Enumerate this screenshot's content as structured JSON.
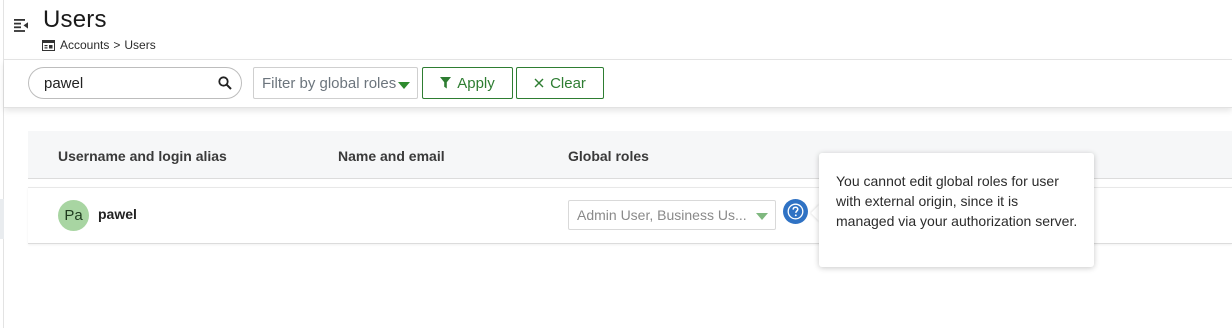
{
  "header": {
    "title": "Users",
    "breadcrumb": {
      "parent": "Accounts",
      "separator": ">",
      "current": "Users"
    }
  },
  "toolbar": {
    "search_value": "pawel",
    "roles_filter_placeholder": "Filter by global roles",
    "apply_label": "Apply",
    "clear_label": "Clear"
  },
  "table": {
    "columns": [
      "Username and login alias",
      "Name and email",
      "Global roles"
    ],
    "rows": [
      {
        "avatar_initials": "Pa",
        "username": "pawel",
        "name_email": "",
        "global_roles": "Admin User, Business Us..."
      }
    ]
  },
  "tooltip": {
    "text": "You cannot edit global roles for user with external origin, since it is managed via your authorization server."
  },
  "icons": {
    "menu": "menu-toggle-icon",
    "breadcrumb": "accounts-icon",
    "search": "search-icon",
    "filter": "filter-icon",
    "clear": "close-icon",
    "help": "help-icon"
  },
  "colors": {
    "accent_green": "#2e7d32",
    "avatar_bg": "#a8d5a2",
    "help_blue": "#2f72c4"
  }
}
